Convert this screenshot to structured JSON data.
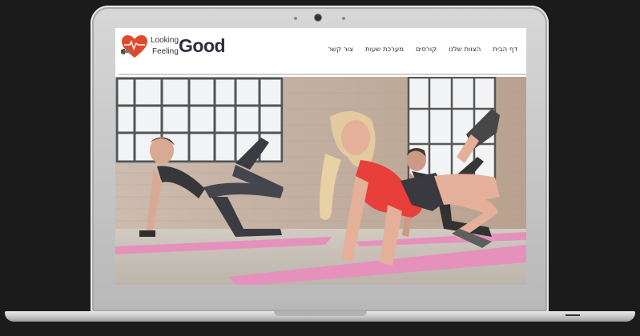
{
  "brand": {
    "line1": "Looking",
    "line2": "Feeling",
    "word": "Good",
    "heart_color": "#e04a2c"
  },
  "nav": {
    "items": [
      {
        "label": "דף הבית"
      },
      {
        "label": "הצוות שלנו"
      },
      {
        "label": "קורסים"
      },
      {
        "label": "מערכת שעות"
      },
      {
        "label": "צור קשר"
      }
    ]
  },
  "hero": {
    "image": "fitness-class-photo",
    "accent_mat": "#e48bb8"
  },
  "device": {
    "frame": "laptop",
    "color": "#c8c8c8"
  }
}
